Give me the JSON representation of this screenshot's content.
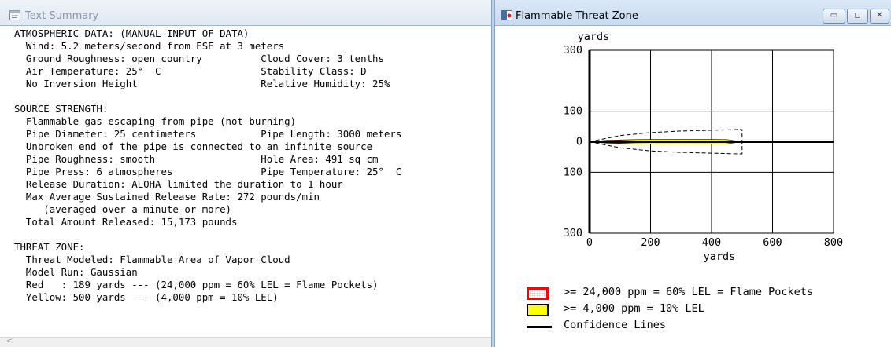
{
  "text_window": {
    "title": "Text Summary",
    "lines": [
      "ATMOSPHERIC DATA: (MANUAL INPUT OF DATA)",
      "  Wind: 5.2 meters/second from ESE at 3 meters",
      "  Ground Roughness: open country          Cloud Cover: 3 tenths",
      "  Air Temperature: 25°  C                 Stability Class: D",
      "  No Inversion Height                     Relative Humidity: 25%",
      "",
      "SOURCE STRENGTH:",
      "  Flammable gas escaping from pipe (not burning)",
      "  Pipe Diameter: 25 centimeters           Pipe Length: 3000 meters",
      "  Unbroken end of the pipe is connected to an infinite source",
      "  Pipe Roughness: smooth                  Hole Area: 491 sq cm",
      "  Pipe Press: 6 atmospheres               Pipe Temperature: 25°  C",
      "  Release Duration: ALOHA limited the duration to 1 hour",
      "  Max Average Sustained Release Rate: 272 pounds/min",
      "     (averaged over a minute or more)",
      "  Total Amount Released: 15,173 pounds",
      "",
      "THREAT ZONE:",
      "  Threat Modeled: Flammable Area of Vapor Cloud",
      "  Model Run: Gaussian",
      "  Red   : 189 yards --- (24,000 ppm = 60% LEL = Flame Pockets)",
      "  Yellow: 500 yards --- (4,000 ppm = 10% LEL)"
    ]
  },
  "threat_window": {
    "title": "Flammable Threat Zone",
    "buttons": {
      "minimize": "▭",
      "restore": "◻",
      "close": "✕"
    }
  },
  "chart_data": {
    "type": "area",
    "y_unit_label": "yards",
    "x_unit_label": "yards",
    "x_ticks": [
      "0",
      "200",
      "400",
      "600",
      "800"
    ],
    "y_ticks": [
      "300",
      "100",
      "0",
      "100",
      "300"
    ],
    "xlim": [
      0,
      800
    ],
    "ylim": [
      -300,
      300
    ],
    "grid": true,
    "series": [
      {
        "name": ">= 24,000 ppm = 60% LEL = Flame Pockets",
        "color": "#ff0000",
        "zone_length": 189,
        "half_width": [
          [
            0,
            0
          ],
          [
            40,
            3
          ],
          [
            100,
            4
          ],
          [
            150,
            3
          ],
          [
            189,
            0
          ]
        ]
      },
      {
        "name": ">= 4,000 ppm = 10% LEL",
        "color": "#ffff00",
        "zone_length": 500,
        "half_width": [
          [
            0,
            0
          ],
          [
            60,
            5
          ],
          [
            150,
            7
          ],
          [
            300,
            8
          ],
          [
            450,
            7
          ],
          [
            500,
            0
          ]
        ]
      },
      {
        "name": "Confidence Lines",
        "color": "#000000",
        "zone_length": 500,
        "half_width": [
          [
            0,
            0
          ],
          [
            100,
            20
          ],
          [
            200,
            30
          ],
          [
            300,
            35
          ],
          [
            420,
            38
          ],
          [
            490,
            40
          ],
          [
            500,
            40
          ]
        ]
      }
    ],
    "legend": [
      {
        "label": ">= 24,000 ppm = 60% LEL = Flame Pockets",
        "swatch": "red"
      },
      {
        "label": ">= 4,000 ppm = 10% LEL",
        "swatch": "yellow"
      },
      {
        "label": "Confidence Lines",
        "swatch": "line"
      }
    ]
  }
}
